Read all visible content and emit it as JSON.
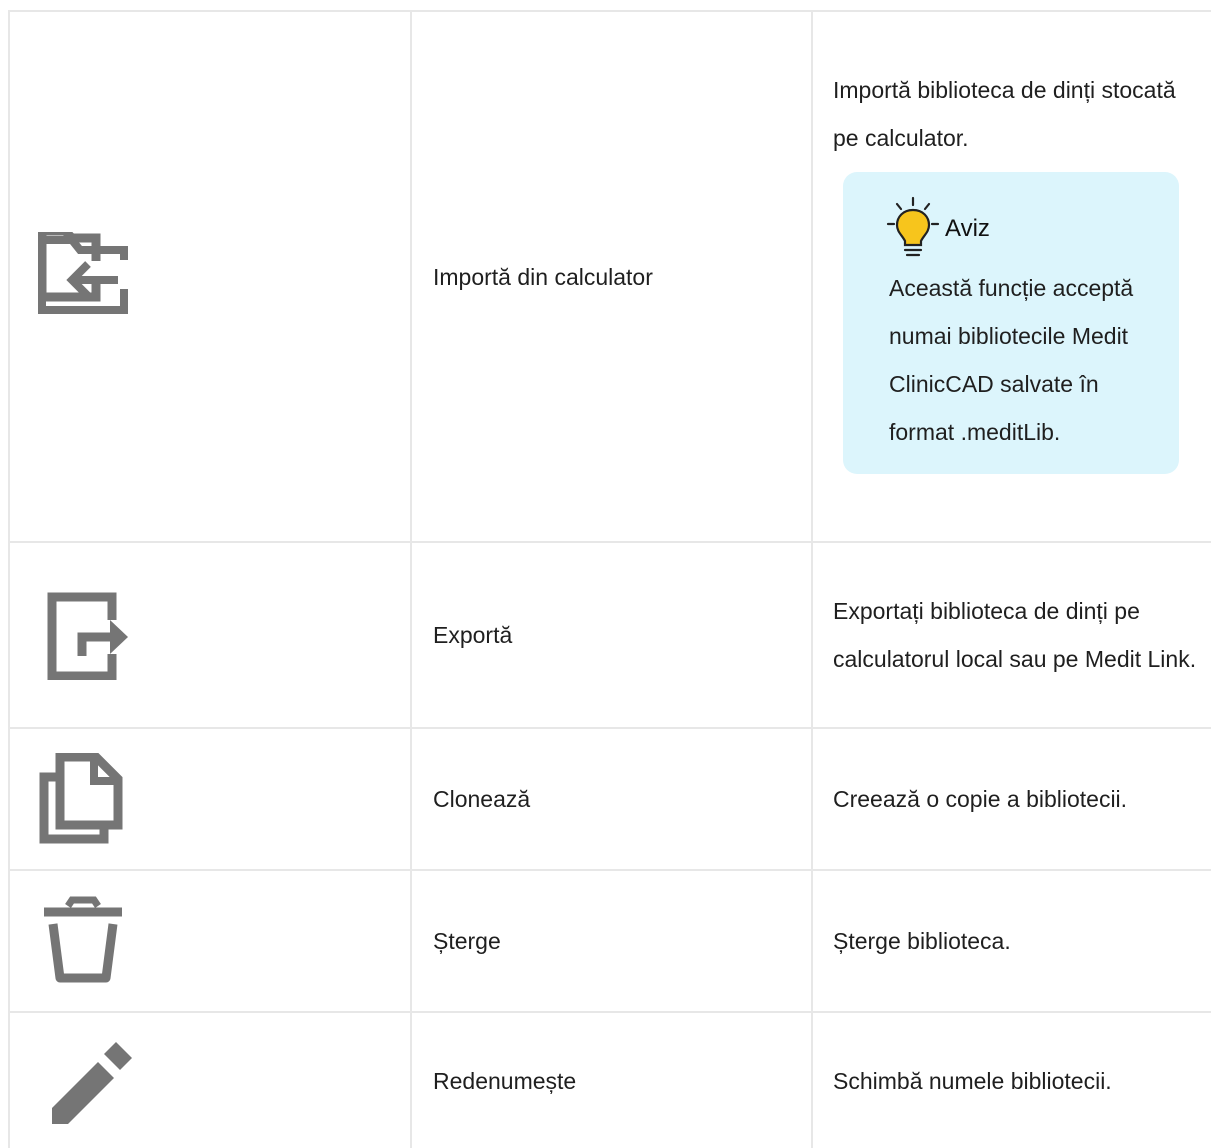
{
  "rows": [
    {
      "icon": "folder-import-icon",
      "name": "Importă din calculator",
      "description": "Importă biblioteca de dinți stocată pe calculator.",
      "notice": {
        "title": "Aviz",
        "body": "Această funcție acceptă numai bibliotecile Medit ClinicCAD salvate în format .meditLib."
      }
    },
    {
      "icon": "export-icon",
      "name": "Exportă",
      "description": "Exportați biblioteca de dinți pe calculatorul local sau pe Medit Link."
    },
    {
      "icon": "clone-icon",
      "name": "Clonează",
      "description": "Creează o copie a bibliotecii."
    },
    {
      "icon": "trash-icon",
      "name": "Șterge",
      "description": "Șterge biblioteca."
    },
    {
      "icon": "pencil-icon",
      "name": "Redenumește",
      "description": "Schimbă numele bibliotecii."
    }
  ],
  "colors": {
    "icon": "#757575",
    "border": "#e7e7e7",
    "notice_bg": "#dcf5fc",
    "bulb": "#f7c51c"
  }
}
